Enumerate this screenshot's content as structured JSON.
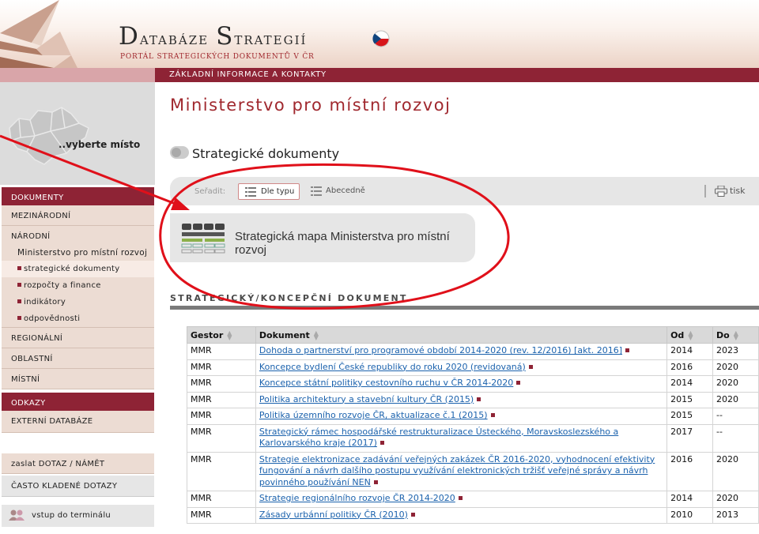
{
  "header": {
    "title_cap": "D",
    "title_rest": "atabáze ",
    "title_cap2": "S",
    "title_rest2": "trategií",
    "subtitle": "PORTÁL STRATEGICKÝCH DOKUMENTŮ V ČR"
  },
  "topnav": {
    "link": "ZÁKLADNÍ INFORMACE A KONTAKTY"
  },
  "sidebar": {
    "map_label": "..vyberte místo",
    "documents_header": "DOKUMENTY",
    "items": [
      {
        "label": "MEZINÁRODNÍ"
      },
      {
        "label": "NÁRODNÍ"
      },
      {
        "label": "Ministerstvo pro místní rozvoj"
      },
      {
        "label": "strategické dokumenty"
      },
      {
        "label": "rozpočty a finance"
      },
      {
        "label": "indikátory"
      },
      {
        "label": "odpovědnosti"
      },
      {
        "label": "REGIONÁLNÍ"
      },
      {
        "label": "OBLASTNÍ"
      },
      {
        "label": "MÍSTNÍ"
      }
    ],
    "links_header": "ODKAZY",
    "external": "EXTERNÍ DATABÁZE",
    "send_question": "zaslat DOTAZ / NÁMĚT",
    "faq": "ČASTO KLADENÉ DOTAZY",
    "terminal": "vstup do terminálu"
  },
  "main": {
    "title": "Ministerstvo pro místní rozvoj",
    "section_toggle_label": "Strategické dokumenty",
    "sort": {
      "label": "Seřadit:",
      "by_type": "Dle typu",
      "alphabetical": "Abecedně",
      "print": "tisk"
    },
    "strategic_map_label": "Strategická mapa Ministerstva pro místní rozvoj",
    "section_heading": "STRATEGICKÝ/KONCEPČNÍ DOKUMENT"
  },
  "table": {
    "columns": [
      "Gestor",
      "Dokument",
      "Od",
      "Do"
    ],
    "rows": [
      {
        "gestor": "MMR",
        "doc": "Dohoda o partnerství pro programové období 2014-2020 (rev. 12/2016) [akt. 2016]",
        "od": "2014",
        "do": "2023"
      },
      {
        "gestor": "MMR",
        "doc": "Koncepce bydlení České republiky do roku 2020 (revidovaná)",
        "od": "2016",
        "do": "2020"
      },
      {
        "gestor": "MMR",
        "doc": "Koncepce státní politiky cestovního ruchu v ČR 2014-2020",
        "od": "2014",
        "do": "2020"
      },
      {
        "gestor": "MMR",
        "doc": "Politika architektury a stavební kultury ČR (2015)",
        "od": "2015",
        "do": "2020"
      },
      {
        "gestor": "MMR",
        "doc": "Politika územního rozvoje ČR, aktualizace č.1 (2015)",
        "od": "2015",
        "do": "--"
      },
      {
        "gestor": "MMR",
        "doc": "Strategický rámec hospodářské restrukturalizace Ústeckého, Moravskoslezského a Karlovarského kraje (2017)",
        "od": "2017",
        "do": "--"
      },
      {
        "gestor": "MMR",
        "doc": "Strategie elektronizace zadávání veřejných zakázek ČR 2016-2020, vyhodnocení efektivity fungování a návrh dalšího postupu využívání elektronických tržišť veřejné správy a návrh povinného používání NEN",
        "od": "2016",
        "do": "2020"
      },
      {
        "gestor": "MMR",
        "doc": "Strategie regionálního rozvoje ČR 2014-2020",
        "od": "2014",
        "do": "2020"
      },
      {
        "gestor": "MMR",
        "doc": "Zásady urbánní politiky ČR (2010)",
        "od": "2010",
        "do": "2013"
      }
    ]
  },
  "colors": {
    "brand": "#8e2335",
    "link": "#1b62ad",
    "annotation": "#e0101a"
  }
}
